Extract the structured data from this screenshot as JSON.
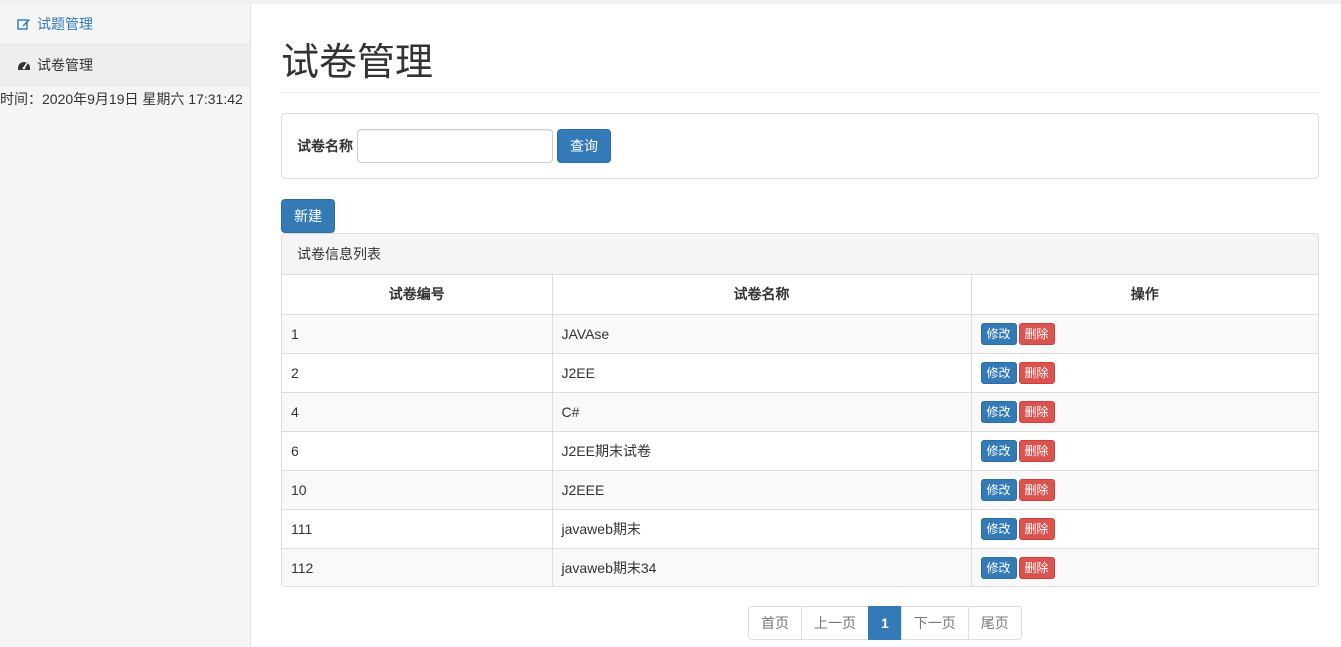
{
  "sidebar": {
    "items": [
      {
        "label": "试题管理",
        "icon": "edit-icon"
      },
      {
        "label": "试卷管理",
        "icon": "dashboard-icon"
      }
    ],
    "time": "时间：2020年9月19日 星期六 17:31:42"
  },
  "main": {
    "title": "试卷管理",
    "search": {
      "label": "试卷名称",
      "value": "",
      "placeholder": "",
      "button": "查询"
    },
    "new_button": "新建",
    "list": {
      "heading": "试卷信息列表",
      "columns": [
        "试卷编号",
        "试卷名称",
        "操作"
      ],
      "rows": [
        {
          "id": "1",
          "name": "JAVAse"
        },
        {
          "id": "2",
          "name": "J2EE"
        },
        {
          "id": "4",
          "name": "C#"
        },
        {
          "id": "6",
          "name": "J2EE期末试卷"
        },
        {
          "id": "10",
          "name": "J2EEE"
        },
        {
          "id": "111",
          "name": "javaweb期末"
        },
        {
          "id": "112",
          "name": "javaweb期末34"
        }
      ],
      "edit_label": "修改",
      "delete_label": "删除"
    },
    "pager": {
      "first": "首页",
      "prev": "上一页",
      "current": "1",
      "next": "下一页",
      "last": "尾页"
    }
  },
  "colors": {
    "primary": "#337ab7",
    "danger": "#d9534f"
  }
}
